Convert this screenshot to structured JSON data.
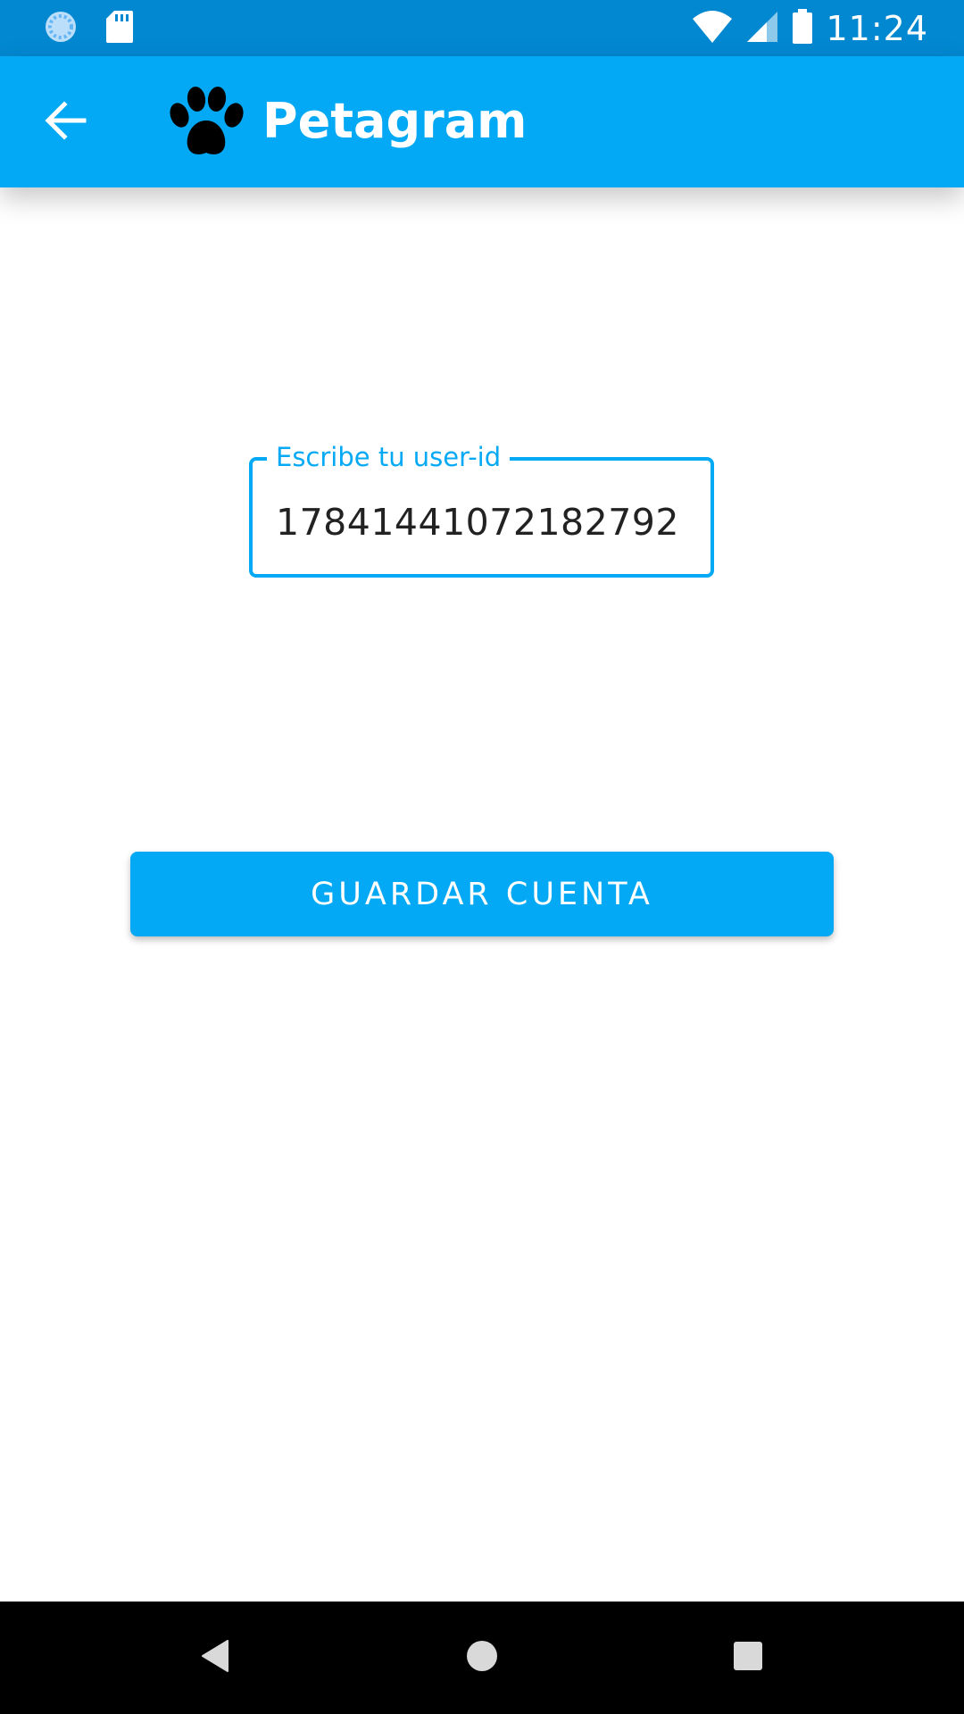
{
  "status_bar": {
    "time": "11:24",
    "icons": [
      "sync-icon",
      "sd-card-icon",
      "wifi-icon",
      "signal-icon",
      "battery-icon"
    ]
  },
  "app_bar": {
    "title": "Petagram",
    "back_icon": "arrow-back-icon",
    "logo_icon": "paw-icon"
  },
  "form": {
    "user_id_label": "Escribe tu user-id",
    "user_id_value": "17841441072182792"
  },
  "actions": {
    "save_label": "GUARDAR CUENTA"
  },
  "nav_bar": {
    "icons": [
      "back-triangle-icon",
      "home-circle-icon",
      "recents-square-icon"
    ]
  },
  "colors": {
    "status_bar": "#0288d1",
    "primary": "#03a9f4",
    "text_dark": "#222222",
    "nav_bar": "#000000"
  }
}
